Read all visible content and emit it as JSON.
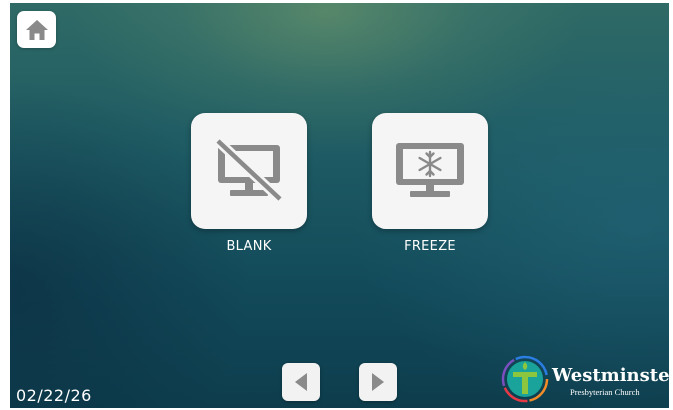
{
  "home": {
    "icon": "home-icon"
  },
  "tiles": [
    {
      "label": "BLANK",
      "icon": "monitor-off-icon"
    },
    {
      "label": "FREEZE",
      "icon": "monitor-snowflake-icon"
    }
  ],
  "nav": {
    "prev_icon": "triangle-left-icon",
    "next_icon": "triangle-right-icon"
  },
  "status": {
    "date": "02/22/26"
  },
  "logo": {
    "name": "Westminster",
    "subtitle": "Presbyterian Church"
  },
  "colors": {
    "icon_gray": "#8a8a8a",
    "tile_bg": "#f5f5f5",
    "text": "#ffffff",
    "bg_top": "#2f6a66",
    "bg_bottom": "#0d3d4d",
    "logo_green": "#8cc63f",
    "logo_teal": "#1aa39a"
  }
}
